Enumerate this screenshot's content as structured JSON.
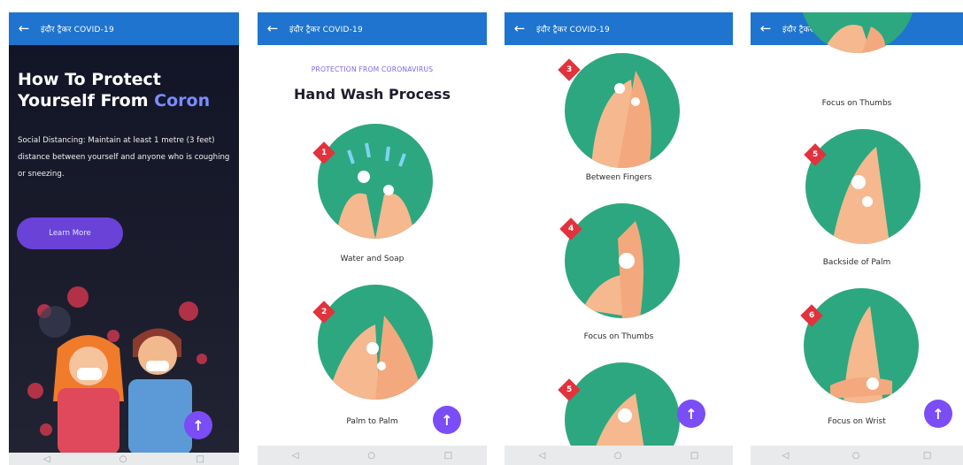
{
  "app_title": "इंदौर ट्रैकर COVID-19",
  "screen1": {
    "headline_line1": "How To Protect",
    "headline_line2_prefix": "Yourself From ",
    "headline_line2_accent": "Coron",
    "paragraph": "Social Distancing: Maintain at least 1 metre (3 feet) distance between yourself and anyone who is coughing or sneezing.",
    "learn_more": "Learn More"
  },
  "screen2": {
    "kicker": "PROTECTION FROM CORONAVIRUS",
    "heading": "Hand Wash Process",
    "steps": [
      {
        "num": "1",
        "caption": "Water and Soap"
      },
      {
        "num": "2",
        "caption": "Palm to Palm"
      }
    ]
  },
  "screen3": {
    "steps": [
      {
        "num": "3",
        "caption": "Between Fingers"
      },
      {
        "num": "4",
        "caption": "Focus on Thumbs"
      },
      {
        "num": "5",
        "caption": ""
      }
    ]
  },
  "screen4": {
    "top_caption": "Focus on Thumbs",
    "steps": [
      {
        "num": "5",
        "caption": "Backside of Palm"
      },
      {
        "num": "6",
        "caption": "Focus on Wrist"
      }
    ]
  },
  "icons": {
    "back": "arrow-left-icon",
    "fab": "arrow-up-icon",
    "nav": [
      "back-triangle-icon",
      "home-circle-icon",
      "recents-square-icon"
    ]
  },
  "colors": {
    "appbar": "#1f74cf",
    "accent": "#7a4df6",
    "circle": "#2da77f",
    "badge": "#e2323d"
  }
}
